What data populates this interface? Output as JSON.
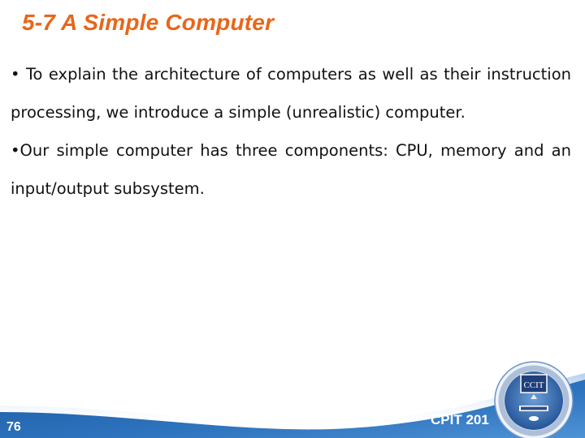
{
  "slide": {
    "title": "5-7  A Simple Computer",
    "bullets": [
      "• To explain the architecture of computers as well as their instruction processing, we introduce a simple (unrealistic) computer.",
      "•Our simple computer has three components: CPU, memory and an input/output subsystem."
    ],
    "footer": {
      "page_number": "76",
      "course_code": "CPIT 201",
      "logo": {
        "icon": "university-seal-icon",
        "center_label": "CCIT"
      }
    }
  },
  "colors": {
    "title": "#e8661a",
    "text": "#111111",
    "wave_dark": "#1f5fa8",
    "wave_light": "#4a8fd4"
  }
}
